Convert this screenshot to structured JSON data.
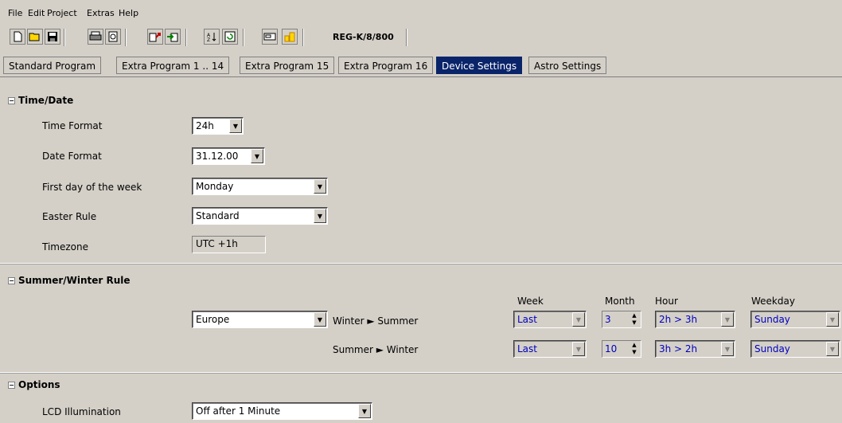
{
  "menu": [
    "File",
    "Edit",
    "Project",
    "Extras",
    "Help"
  ],
  "toolbar": {
    "device_name": "REG-K/8/800",
    "icons": [
      "new-icon",
      "open-icon",
      "save-icon",
      "print-icon",
      "print-preview-icon",
      "upload-icon",
      "download-icon",
      "sort-icon",
      "refresh-icon",
      "device-icon",
      "folder-icon"
    ]
  },
  "tabs": [
    {
      "label": "Standard Program",
      "active": false
    },
    {
      "label": "Extra Program 1 .. 14",
      "active": false
    },
    {
      "label": "Extra Program 15",
      "active": false
    },
    {
      "label": "Extra Program 16",
      "active": false
    },
    {
      "label": "Device Settings",
      "active": true
    },
    {
      "label": "Astro Settings",
      "active": false
    }
  ],
  "time_date": {
    "title": "Time/Date",
    "time_format_label": "Time Format",
    "time_format_value": "24h",
    "date_format_label": "Date Format",
    "date_format_value": "31.12.00",
    "first_day_label": "First day of the week",
    "first_day_value": "Monday",
    "easter_label": "Easter Rule",
    "easter_value": "Standard",
    "timezone_label": "Timezone",
    "timezone_value": "UTC +1h"
  },
  "summer_winter": {
    "title": "Summer/Winter Rule",
    "region_value": "Europe",
    "col_week": "Week",
    "col_month": "Month",
    "col_hour": "Hour",
    "col_weekday": "Weekday",
    "rows": [
      {
        "label": "Winter ► Summer",
        "week": "Last",
        "month": "3",
        "hour": "2h > 3h",
        "weekday": "Sunday"
      },
      {
        "label": "Summer ► Winter",
        "week": "Last",
        "month": "10",
        "hour": "3h > 2h",
        "weekday": "Sunday"
      }
    ]
  },
  "options": {
    "title": "Options",
    "lcd_label": "LCD Illumination",
    "lcd_value": "Off after 1 Minute"
  }
}
